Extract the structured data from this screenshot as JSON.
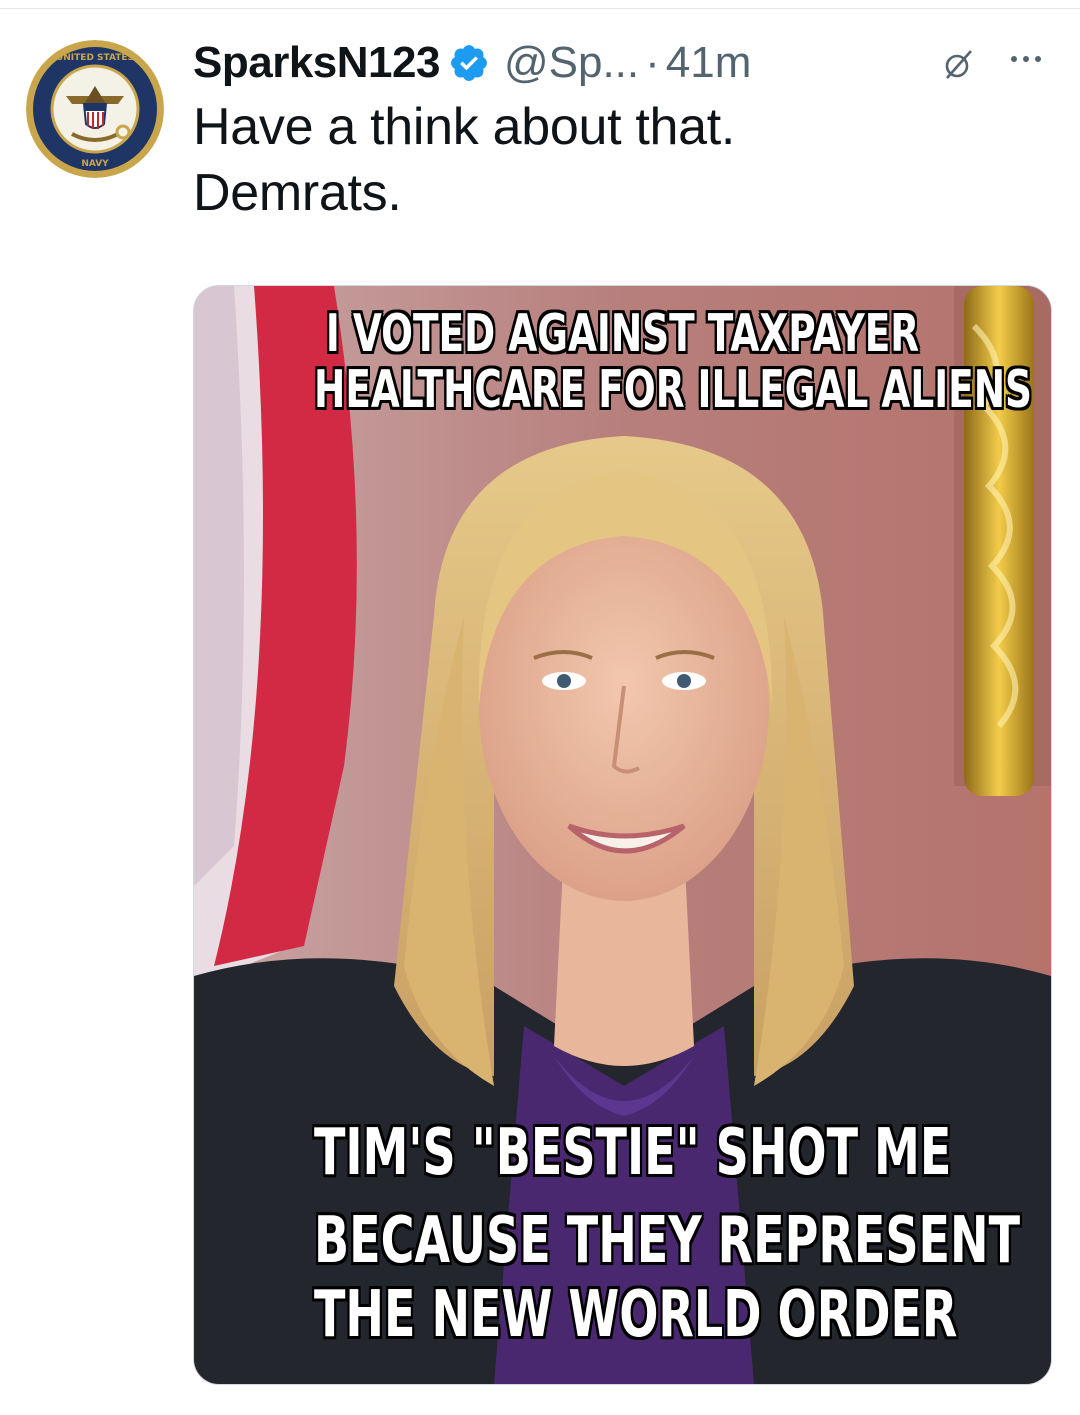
{
  "post": {
    "display_name": "SparksN123",
    "handle": "@Sp...",
    "separator": "·",
    "time": "41m",
    "text_lines": [
      "Have a think about that.",
      "Demrats."
    ]
  },
  "meme": {
    "top_caption": [
      "I VOTED AGAINST TAXPAYER",
      "HEALTHCARE FOR ILLEGAL ALIENS"
    ],
    "bottom_caption": [
      "TIM'S \"BESTIE\" SHOT ME",
      "BECAUSE THEY REPRESENT",
      "THE NEW WORLD ORDER"
    ]
  },
  "icons": {
    "avatar": "navy-seal-icon",
    "verified": "verified-badge-icon",
    "grok": "grok-icon",
    "more": "more-options-icon"
  },
  "colors": {
    "verified_blue": "#1d9bf0",
    "secondary_text": "#536471",
    "primary_text": "#0f1419"
  }
}
